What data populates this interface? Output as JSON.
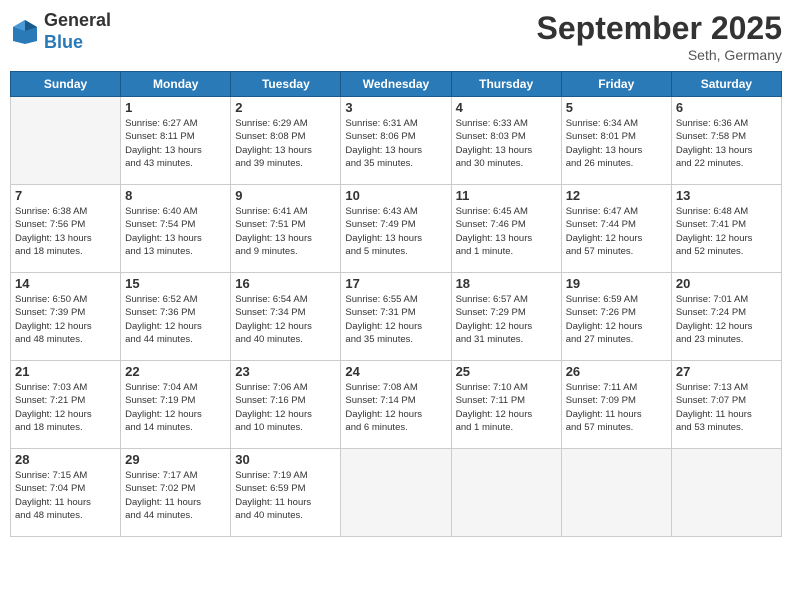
{
  "logo": {
    "general": "General",
    "blue": "Blue"
  },
  "title": "September 2025",
  "subtitle": "Seth, Germany",
  "days": [
    "Sunday",
    "Monday",
    "Tuesday",
    "Wednesday",
    "Thursday",
    "Friday",
    "Saturday"
  ],
  "weeks": [
    [
      {
        "day": "",
        "info": ""
      },
      {
        "day": "1",
        "info": "Sunrise: 6:27 AM\nSunset: 8:11 PM\nDaylight: 13 hours\nand 43 minutes."
      },
      {
        "day": "2",
        "info": "Sunrise: 6:29 AM\nSunset: 8:08 PM\nDaylight: 13 hours\nand 39 minutes."
      },
      {
        "day": "3",
        "info": "Sunrise: 6:31 AM\nSunset: 8:06 PM\nDaylight: 13 hours\nand 35 minutes."
      },
      {
        "day": "4",
        "info": "Sunrise: 6:33 AM\nSunset: 8:03 PM\nDaylight: 13 hours\nand 30 minutes."
      },
      {
        "day": "5",
        "info": "Sunrise: 6:34 AM\nSunset: 8:01 PM\nDaylight: 13 hours\nand 26 minutes."
      },
      {
        "day": "6",
        "info": "Sunrise: 6:36 AM\nSunset: 7:58 PM\nDaylight: 13 hours\nand 22 minutes."
      }
    ],
    [
      {
        "day": "7",
        "info": "Sunrise: 6:38 AM\nSunset: 7:56 PM\nDaylight: 13 hours\nand 18 minutes."
      },
      {
        "day": "8",
        "info": "Sunrise: 6:40 AM\nSunset: 7:54 PM\nDaylight: 13 hours\nand 13 minutes."
      },
      {
        "day": "9",
        "info": "Sunrise: 6:41 AM\nSunset: 7:51 PM\nDaylight: 13 hours\nand 9 minutes."
      },
      {
        "day": "10",
        "info": "Sunrise: 6:43 AM\nSunset: 7:49 PM\nDaylight: 13 hours\nand 5 minutes."
      },
      {
        "day": "11",
        "info": "Sunrise: 6:45 AM\nSunset: 7:46 PM\nDaylight: 13 hours\nand 1 minute."
      },
      {
        "day": "12",
        "info": "Sunrise: 6:47 AM\nSunset: 7:44 PM\nDaylight: 12 hours\nand 57 minutes."
      },
      {
        "day": "13",
        "info": "Sunrise: 6:48 AM\nSunset: 7:41 PM\nDaylight: 12 hours\nand 52 minutes."
      }
    ],
    [
      {
        "day": "14",
        "info": "Sunrise: 6:50 AM\nSunset: 7:39 PM\nDaylight: 12 hours\nand 48 minutes."
      },
      {
        "day": "15",
        "info": "Sunrise: 6:52 AM\nSunset: 7:36 PM\nDaylight: 12 hours\nand 44 minutes."
      },
      {
        "day": "16",
        "info": "Sunrise: 6:54 AM\nSunset: 7:34 PM\nDaylight: 12 hours\nand 40 minutes."
      },
      {
        "day": "17",
        "info": "Sunrise: 6:55 AM\nSunset: 7:31 PM\nDaylight: 12 hours\nand 35 minutes."
      },
      {
        "day": "18",
        "info": "Sunrise: 6:57 AM\nSunset: 7:29 PM\nDaylight: 12 hours\nand 31 minutes."
      },
      {
        "day": "19",
        "info": "Sunrise: 6:59 AM\nSunset: 7:26 PM\nDaylight: 12 hours\nand 27 minutes."
      },
      {
        "day": "20",
        "info": "Sunrise: 7:01 AM\nSunset: 7:24 PM\nDaylight: 12 hours\nand 23 minutes."
      }
    ],
    [
      {
        "day": "21",
        "info": "Sunrise: 7:03 AM\nSunset: 7:21 PM\nDaylight: 12 hours\nand 18 minutes."
      },
      {
        "day": "22",
        "info": "Sunrise: 7:04 AM\nSunset: 7:19 PM\nDaylight: 12 hours\nand 14 minutes."
      },
      {
        "day": "23",
        "info": "Sunrise: 7:06 AM\nSunset: 7:16 PM\nDaylight: 12 hours\nand 10 minutes."
      },
      {
        "day": "24",
        "info": "Sunrise: 7:08 AM\nSunset: 7:14 PM\nDaylight: 12 hours\nand 6 minutes."
      },
      {
        "day": "25",
        "info": "Sunrise: 7:10 AM\nSunset: 7:11 PM\nDaylight: 12 hours\nand 1 minute."
      },
      {
        "day": "26",
        "info": "Sunrise: 7:11 AM\nSunset: 7:09 PM\nDaylight: 11 hours\nand 57 minutes."
      },
      {
        "day": "27",
        "info": "Sunrise: 7:13 AM\nSunset: 7:07 PM\nDaylight: 11 hours\nand 53 minutes."
      }
    ],
    [
      {
        "day": "28",
        "info": "Sunrise: 7:15 AM\nSunset: 7:04 PM\nDaylight: 11 hours\nand 48 minutes."
      },
      {
        "day": "29",
        "info": "Sunrise: 7:17 AM\nSunset: 7:02 PM\nDaylight: 11 hours\nand 44 minutes."
      },
      {
        "day": "30",
        "info": "Sunrise: 7:19 AM\nSunset: 6:59 PM\nDaylight: 11 hours\nand 40 minutes."
      },
      {
        "day": "",
        "info": ""
      },
      {
        "day": "",
        "info": ""
      },
      {
        "day": "",
        "info": ""
      },
      {
        "day": "",
        "info": ""
      }
    ]
  ]
}
